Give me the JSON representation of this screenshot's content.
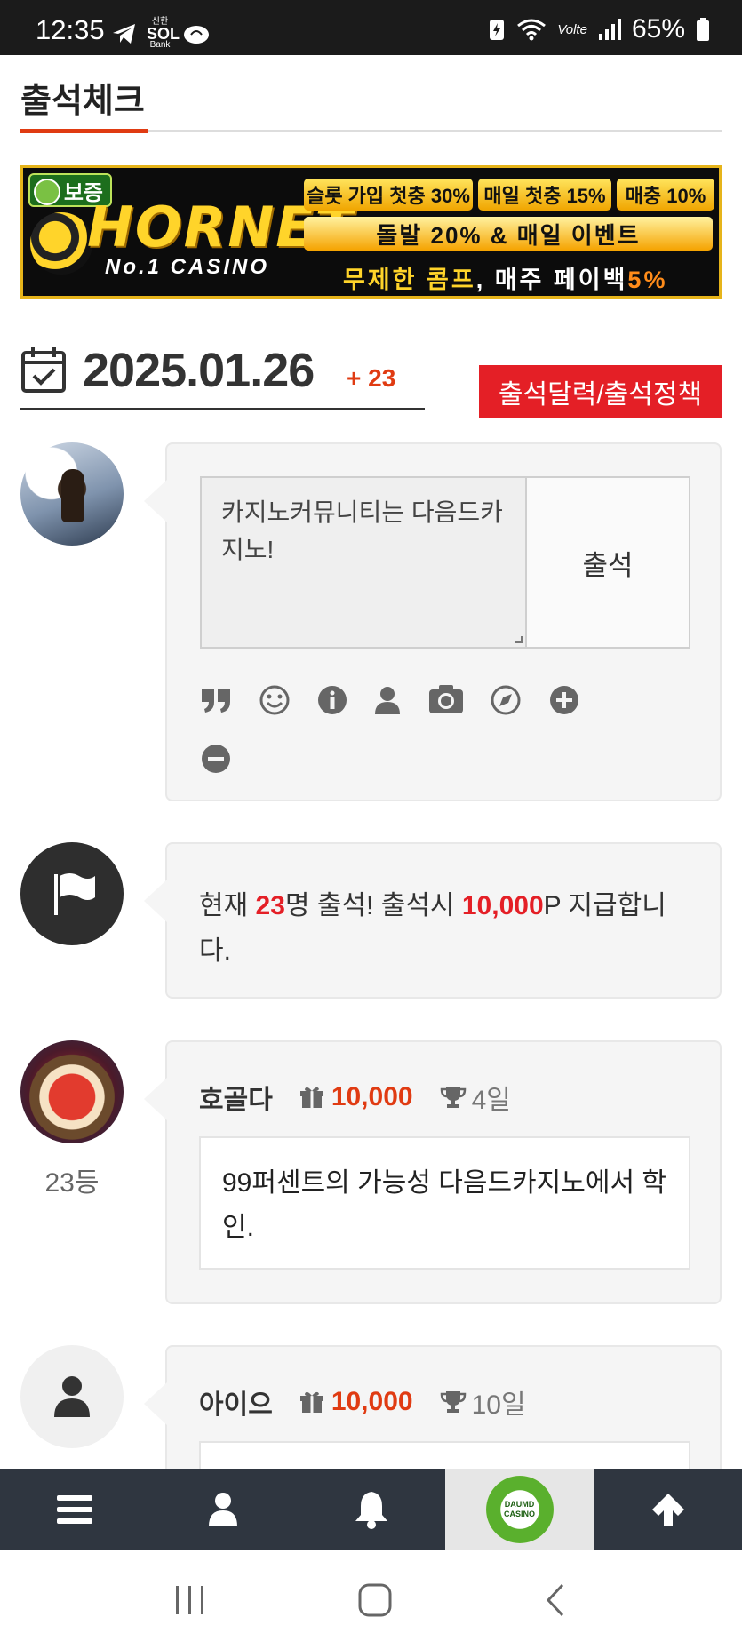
{
  "status_bar": {
    "time": "12:35",
    "bank_top": "신한",
    "bank_bottom": "Bank",
    "network": "Volte",
    "battery": "65%"
  },
  "page": {
    "title": "출석체크"
  },
  "banner": {
    "badge": "보증",
    "logo": "HORNET",
    "subtitle": "No.1 CASINO",
    "tag1": "슬롯 가입 첫충 30%",
    "tag2": "매일 첫충 15%",
    "tag3": "매충 10%",
    "wide": "돌발 20% & 매일 이벤트",
    "bottom_a": "무제한 콤프",
    "bottom_b": ", 매주 페이백",
    "bottom_c": "5%"
  },
  "attendance": {
    "date": "2025.01.26",
    "plus": "+ 23",
    "policy_button": "출석달력/출석정책",
    "comment_text": "카지노커뮤니티는 다음드카지노!",
    "checkin_button": "출석"
  },
  "notice": {
    "prefix": "현재 ",
    "count": "23",
    "middle": "명 출석! 출석시 ",
    "points": "10,000",
    "suffix": "P 지급합니다."
  },
  "posts": [
    {
      "name": "호골다",
      "points": "10,000",
      "days": "4일",
      "rank": "23등",
      "body": "99퍼센트의 가능성 다음드카지노에서 학인."
    },
    {
      "name": "아이으",
      "points": "10,000",
      "days": "10일",
      "body": ""
    }
  ],
  "bottom_nav": {
    "logo_text_top": "DAUMD",
    "logo_text_bottom": "CASINO"
  },
  "icons": {
    "toolbar": [
      "quote-icon",
      "smile-icon",
      "info-icon",
      "user-icon",
      "camera-icon",
      "compass-icon",
      "plus-circle-icon",
      "minus-circle-icon"
    ]
  },
  "colors": {
    "accent": "#e03b12",
    "policy_red": "#e41f26",
    "nav_bg": "#2f3640"
  }
}
